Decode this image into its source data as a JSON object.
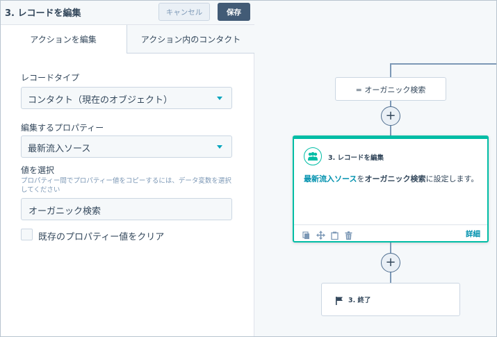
{
  "header": {
    "title": "3. レコードを編集",
    "cancel_label": "キャンセル",
    "save_label": "保存"
  },
  "tabs": [
    {
      "label": "アクションを編集",
      "active": true
    },
    {
      "label": "アクション内のコンタクト",
      "active": false
    }
  ],
  "form": {
    "record_type_label": "レコードタイプ",
    "record_type_value": "コンタクト（現在のオブジェクト）",
    "property_label": "編集するプロパティー",
    "property_value": "最新流入ソース",
    "value_label": "値を選択",
    "value_help": "プロパティー間でプロパティー値をコピーするには、データ変数を選択してください",
    "value_value": "オーガニック検索",
    "clear_checkbox_label": "既存のプロパティー値をクリア",
    "clear_checked": false
  },
  "canvas": {
    "branch_node_label": "= オーガニック検索",
    "action_card": {
      "title": "3. レコードを編集",
      "body_property": "最新流入ソース",
      "body_connector_1": "を",
      "body_value": "オーガニック検索",
      "body_connector_2": "に設定します。",
      "details_label": "詳細",
      "icon": "contacts-icon"
    },
    "end_node_label": "3. 終了",
    "end_icon": "flag-icon"
  },
  "colors": {
    "accent": "#00bda5",
    "link": "#0091ae",
    "primary_button": "#425b76",
    "dropdown_caret": "#00a4bd"
  }
}
